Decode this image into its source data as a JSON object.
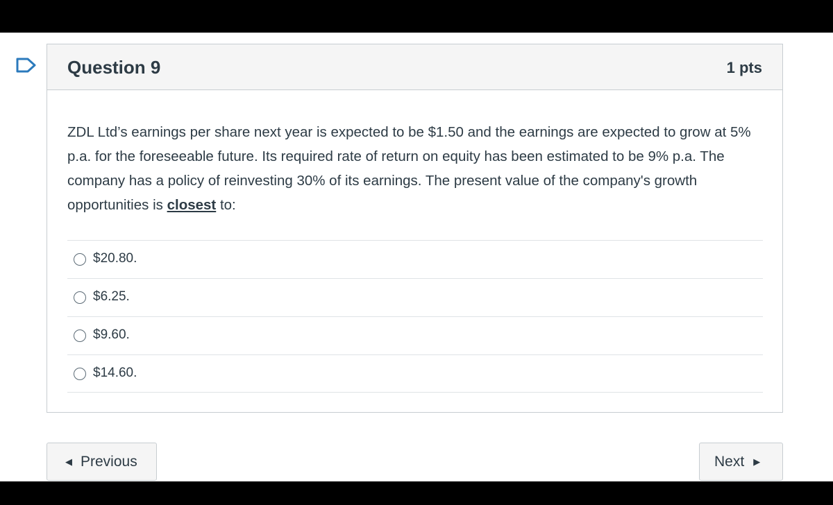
{
  "question": {
    "title": "Question 9",
    "points": "1 pts",
    "text_before": "ZDL Ltd’s earnings per share next year is expected to be $1.50 and the earnings are expected to grow at 5% p.a. for the foreseeable future. Its required rate of return on equity has been estimated to be 9% p.a. The company has a policy of reinvesting 30% of its earnings. The present value of the company's growth opportunities is ",
    "text_emphasis": "closest",
    "text_after": " to:"
  },
  "answers": [
    {
      "label": "$20.80."
    },
    {
      "label": "$6.25."
    },
    {
      "label": "$9.60."
    },
    {
      "label": "$14.60."
    }
  ],
  "nav": {
    "previous_label": "Previous",
    "next_label": "Next"
  },
  "icons": {
    "flag": "flag-question-icon",
    "previous": "triangle-left-icon",
    "next": "triangle-right-icon"
  },
  "colors": {
    "accent": "#2d3b45",
    "flag": "#2b7abc",
    "header_bg": "#f5f5f5",
    "border": "#c7cdd1"
  }
}
